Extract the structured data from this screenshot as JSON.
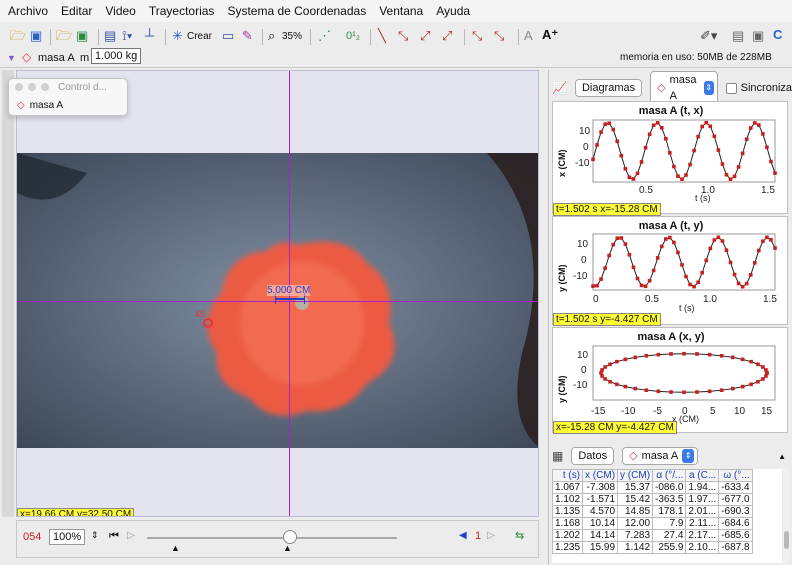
{
  "menu": [
    "Archivo",
    "Editar",
    "Video",
    "Trayectorias",
    "Systema de Coordenadas",
    "Ventana",
    "Ayuda"
  ],
  "toolbar": {
    "create_label": "Crear",
    "zoom": "35%",
    "mass_track_name": "masa A",
    "mass_label": "m",
    "mass_value": "1.000 kg",
    "memory_text": "memoria en uso: 50MB de 228MB"
  },
  "control_window": {
    "title": "Control d...",
    "track": "masa A"
  },
  "video": {
    "scale_label": "5.000 CM",
    "marker_label": "45",
    "readout": "x=19.66 CM  y=32.50 CM"
  },
  "player": {
    "frame": "054",
    "speed": "100%",
    "step": "1"
  },
  "panel": {
    "tab_label": "Diagramas",
    "track": "masa A",
    "sync_label": "Sincroniza"
  },
  "plots": [
    {
      "title": "masa A (t, x)",
      "ylabel": "x (CM)",
      "xlabel": "t (s)",
      "readout": "t=1.502 s  x=-15.28 CM",
      "xticks": [
        "0.5",
        "1.0",
        "1.5"
      ],
      "yticks": [
        "10",
        "0",
        "-10"
      ]
    },
    {
      "title": "masa A (t, y)",
      "ylabel": "y (CM)",
      "xlabel": "t (s)",
      "readout": "t=1.502 s  y=-4.427 CM",
      "xticks": [
        "0",
        "0.5",
        "1.0",
        "1.5"
      ],
      "yticks": [
        "10",
        "0",
        "-10"
      ]
    },
    {
      "title": "masa A (x, y)",
      "ylabel": "y (CM)",
      "xlabel": "x (CM)",
      "readout": "x=-15.28 CM  y=-4.427 CM",
      "xticks": [
        "-15",
        "-10",
        "-5",
        "0",
        "5",
        "10",
        "15"
      ],
      "yticks": [
        "10",
        "0",
        "-10"
      ]
    }
  ],
  "chart_data": [
    {
      "type": "line",
      "title": "masa A (t, x)",
      "xlabel": "t (s)",
      "ylabel": "x (CM)",
      "xlim": [
        0,
        1.55
      ],
      "ylim": [
        -17,
        17
      ],
      "period": 0.42,
      "amplitude": 15.5,
      "phase": 0.02,
      "points": 46
    },
    {
      "type": "line",
      "title": "masa A (t, y)",
      "xlabel": "t (s)",
      "ylabel": "y (CM)",
      "xlim": [
        0,
        1.55
      ],
      "ylim": [
        -17,
        17
      ],
      "period": 0.42,
      "amplitude": 15,
      "phase": 0.12,
      "points": 46
    },
    {
      "type": "scatter",
      "title": "masa A (x, y)",
      "xlabel": "x (CM)",
      "ylabel": "y (CM)",
      "xlim": [
        -17,
        17
      ],
      "ylim": [
        -14,
        14
      ],
      "rx": 15.5,
      "ry": 10,
      "points": 40
    }
  ],
  "data_panel": {
    "tab_label": "Datos",
    "track": "masa A"
  },
  "table": {
    "headers": [
      "t (s)",
      "x (CM)",
      "y (CM)",
      "α (°/...",
      "a (C...",
      "ω (°..."
    ],
    "rows": [
      [
        "1.067",
        "-7.308",
        "15.37",
        "-086.0",
        "1.94...",
        "-633.4"
      ],
      [
        "1.102",
        "-1.571",
        "15.42",
        "-363.5",
        "1.97...",
        "-677.0"
      ],
      [
        "1.135",
        "4.570",
        "14.85",
        "178.1",
        "2.01...",
        "-690.3"
      ],
      [
        "1.168",
        "10.14",
        "12.00",
        "7.9",
        "2.11...",
        "-684.6"
      ],
      [
        "1.202",
        "14.14",
        "7.283",
        "27.4",
        "2.17...",
        "-685.6"
      ],
      [
        "1.235",
        "15.99",
        "1.142",
        "255.9",
        "2.10...",
        "-687.8"
      ]
    ]
  },
  "colors": {
    "accent": "#3b7be8",
    "track": "#e8333a",
    "axes": "#aa22cc",
    "readout_bg": "#ffff33"
  }
}
